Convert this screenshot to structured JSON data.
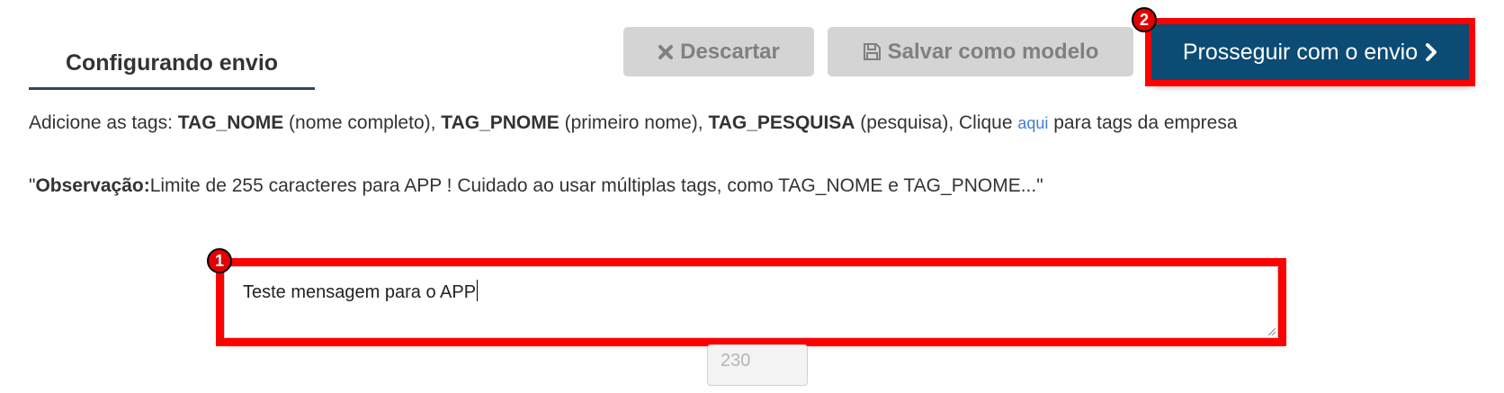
{
  "header": {
    "tab_title": "Configurando envio",
    "discard_label": "Descartar",
    "save_template_label": "Salvar como modelo",
    "proceed_label": "Prosseguir com o envio"
  },
  "callouts": {
    "badge_1": "1",
    "badge_2": "2"
  },
  "tags_line": {
    "intro": "Adicione as tags: ",
    "tag_nome": "TAG_NOME",
    "tag_nome_desc": " (nome completo), ",
    "tag_pnome": "TAG_PNOME",
    "tag_pnome_desc": " (primeiro nome), ",
    "tag_pesquisa": "TAG_PESQUISA",
    "tag_pesquisa_desc": " (pesquisa), Clique ",
    "link_text": "aqui",
    "outro": " para tags da empresa"
  },
  "observation": {
    "open_quote": "\"",
    "label": "Observação:",
    "text": "Limite de 255 caracteres para APP ! Cuidado ao usar múltiplas tags, como TAG_NOME e TAG_PNOME...\""
  },
  "message": {
    "value": "Teste mensagem para o APP"
  },
  "counter": {
    "remaining": "230"
  },
  "icons": {
    "discard": "close-icon",
    "save": "floppy-disk-icon",
    "proceed": "chevron-right-icon"
  },
  "colors": {
    "primary_button": "#0c4b73",
    "highlight": "#ff0000",
    "link": "#3f7fd0",
    "disabled_button": "#d4d4d4"
  }
}
